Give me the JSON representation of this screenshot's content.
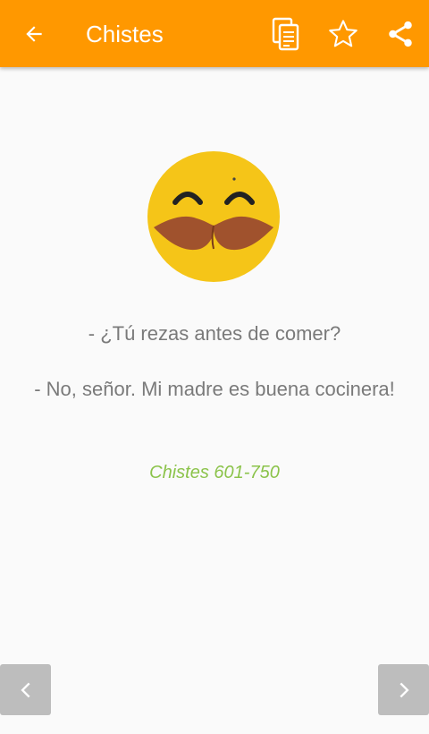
{
  "appbar": {
    "title": "Chistes",
    "color": "#ff9800",
    "icons": [
      "back-arrow-icon",
      "copy-icon",
      "star-outline-icon",
      "share-icon"
    ]
  },
  "joke": {
    "icon": "mustache-smiley-icon",
    "question": "- ¿Tú rezas antes de comer?",
    "answer": "- No, señor. Mi madre es buena cocinera!"
  },
  "category": {
    "label": "Chistes 601-750",
    "color": "#8bc34a"
  },
  "navigation": {
    "prev_icon": "chevron-left-icon",
    "next_icon": "chevron-right-icon"
  }
}
